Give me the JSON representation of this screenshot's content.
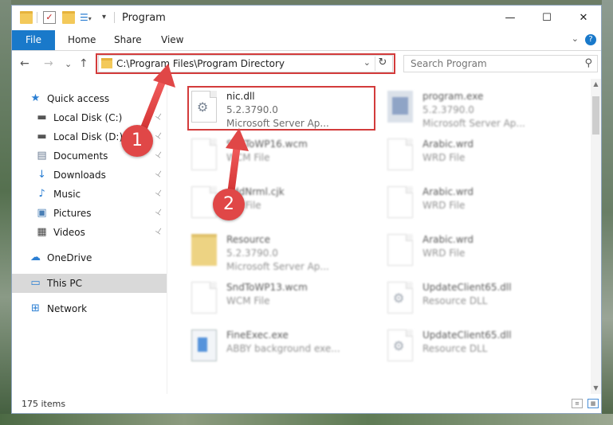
{
  "window": {
    "title": "Program",
    "controls": {
      "minimize": "—",
      "maximize": "☐",
      "close": "✕"
    }
  },
  "ribbon": {
    "tabs": [
      "File",
      "Home",
      "Share",
      "View"
    ],
    "chevron": "⌄",
    "help": "?"
  },
  "nav": {
    "back": "←",
    "forward": "→",
    "recent": "⌄",
    "up": "↑",
    "address": "C:\\Program Files\\Program Directory",
    "address_dropdown": "⌄",
    "refresh": "↻",
    "search_placeholder": "Search Program",
    "search_icon": "⚲"
  },
  "sidebar": {
    "items": [
      {
        "label": "Quick access",
        "icon": "star-icon",
        "glyph": "★",
        "color": "#2b7fd3",
        "pinned": false
      },
      {
        "label": "Local Disk (C:)",
        "icon": "drive-icon",
        "glyph": "▬",
        "color": "#555555",
        "pinned": true
      },
      {
        "label": "Local Disk (D:)",
        "icon": "drive-icon",
        "glyph": "▬",
        "color": "#555555",
        "pinned": true
      },
      {
        "label": "Documents",
        "icon": "documents-icon",
        "glyph": "▤",
        "color": "#6b7c93",
        "pinned": true
      },
      {
        "label": "Downloads",
        "icon": "downloads-icon",
        "glyph": "↓",
        "color": "#2b7fd3",
        "pinned": true
      },
      {
        "label": "Music",
        "icon": "music-icon",
        "glyph": "♪",
        "color": "#2b7fd3",
        "pinned": true
      },
      {
        "label": "Pictures",
        "icon": "pictures-icon",
        "glyph": "▣",
        "color": "#4a7fb5",
        "pinned": true
      },
      {
        "label": "Videos",
        "icon": "videos-icon",
        "glyph": "▦",
        "color": "#444444",
        "pinned": true
      },
      {
        "label": "OneDrive",
        "icon": "onedrive-icon",
        "glyph": "☁",
        "color": "#2b7fd3",
        "pinned": false
      },
      {
        "label": "This PC",
        "icon": "pc-icon",
        "glyph": "▭",
        "color": "#2b7fd3",
        "pinned": false
      },
      {
        "label": "Network",
        "icon": "network-icon",
        "glyph": "⊞",
        "color": "#2b7fd3",
        "pinned": false
      }
    ],
    "pin_glyph": "📌"
  },
  "files": [
    {
      "name": "nic.dll",
      "line2": "5.2.3790.0",
      "line3": "Microsoft Server Ap...",
      "icon": "gear",
      "highlighted": true
    },
    {
      "name": "program.exe",
      "line2": "5.2.3790.0",
      "line3": "Microsoft Server Ap...",
      "icon": "exe"
    },
    {
      "name": "SndToWP16.wcm",
      "line2": "WCM File",
      "line3": "",
      "icon": "doc"
    },
    {
      "name": "Arabic.wrd",
      "line2": "WRD File",
      "line3": "",
      "icon": "doc"
    },
    {
      "name": "AddNrml.cjk",
      "line2": "CJK File",
      "line3": "",
      "icon": "doc"
    },
    {
      "name": "Arabic.wrd",
      "line2": "WRD File",
      "line3": "",
      "icon": "doc"
    },
    {
      "name": "Resource",
      "line2": "5.2.3790.0",
      "line3": "Microsoft Server Ap...",
      "icon": "folder"
    },
    {
      "name": "Arabic.wrd",
      "line2": "WRD File",
      "line3": "",
      "icon": "doc"
    },
    {
      "name": "SndToWP13.wcm",
      "line2": "WCM File",
      "line3": "",
      "icon": "doc"
    },
    {
      "name": "UpdateClient65.dll",
      "line2": "Resource DLL",
      "line3": "",
      "icon": "gear"
    },
    {
      "name": "FineExec.exe",
      "line2": "ABBY background exe...",
      "line3": "",
      "icon": "fine"
    },
    {
      "name": "UpdateClient65.dll",
      "line2": "Resource DLL",
      "line3": "",
      "icon": "gear"
    }
  ],
  "status": {
    "items_count": "175 items"
  },
  "callouts": [
    {
      "number": "1"
    },
    {
      "number": "2"
    }
  ],
  "colors": {
    "accent": "#1979ca",
    "highlight": "#d33b3b",
    "callout": "#e04747"
  }
}
